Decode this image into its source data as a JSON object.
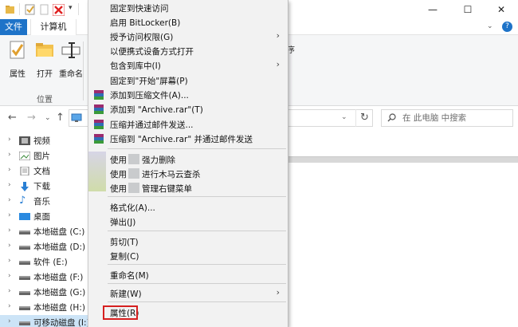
{
  "ribbon": {
    "tabs": [
      "文件",
      "计算机"
    ],
    "buttons": [
      "属性",
      "打开",
      "重命名"
    ],
    "group_label": "位置",
    "partial_label": "序"
  },
  "address": {
    "search_placeholder": "在 此电脑 中搜索"
  },
  "nav_pane": {
    "items": [
      {
        "label": "视频",
        "icon": "video-icon"
      },
      {
        "label": "图片",
        "icon": "pictures-icon"
      },
      {
        "label": "文档",
        "icon": "documents-icon"
      },
      {
        "label": "下载",
        "icon": "download-icon"
      },
      {
        "label": "音乐",
        "icon": "music-icon"
      },
      {
        "label": "桌面",
        "icon": "desktop-icon"
      },
      {
        "label": "本地磁盘 (C:)",
        "icon": "drive-icon"
      },
      {
        "label": "本地磁盘 (D:)",
        "icon": "drive-icon"
      },
      {
        "label": "软件 (E:)",
        "icon": "drive-icon"
      },
      {
        "label": "本地磁盘 (F:)",
        "icon": "drive-icon"
      },
      {
        "label": "本地磁盘 (G:)",
        "icon": "drive-icon"
      },
      {
        "label": "本地磁盘 (H:)",
        "icon": "drive-icon"
      },
      {
        "label": "可移动磁盘 (I:)",
        "icon": "usb-drive-icon"
      }
    ]
  },
  "context_menu": {
    "items": [
      {
        "label": "固定到快速访问",
        "has_submenu": false
      },
      {
        "label": "启用 BitLocker(B)",
        "has_submenu": false
      },
      {
        "label": "授予访问权限(G)",
        "has_submenu": true
      },
      {
        "label": "以便携式设备方式打开",
        "has_submenu": false
      },
      {
        "label": "包含到库中(I)",
        "has_submenu": true
      },
      {
        "label": "固定到\"开始\"屏幕(P)",
        "has_submenu": false
      },
      {
        "label": "添加到压缩文件(A)...",
        "has_submenu": false,
        "icon": "winrar-icon"
      },
      {
        "label": "添加到 \"Archive.rar\"(T)",
        "has_submenu": false,
        "icon": "winrar-icon"
      },
      {
        "label": "压缩并通过邮件发送...",
        "has_submenu": false,
        "icon": "winrar-icon"
      },
      {
        "label": "压缩到 \"Archive.rar\" 并通过邮件发送",
        "has_submenu": false,
        "icon": "winrar-icon"
      },
      {
        "label": "使用",
        "suffix": "强力删除",
        "has_submenu": false
      },
      {
        "label": "使用",
        "suffix": "进行木马云查杀",
        "has_submenu": false
      },
      {
        "label": "使用",
        "suffix": "管理右键菜单",
        "has_submenu": false
      },
      {
        "label": "格式化(A)...",
        "has_submenu": false
      },
      {
        "label": "弹出(J)",
        "has_submenu": false
      },
      {
        "label": "剪切(T)",
        "has_submenu": false
      },
      {
        "label": "复制(C)",
        "has_submenu": false
      },
      {
        "label": "重命名(M)",
        "has_submenu": false
      },
      {
        "label": "新建(W)",
        "has_submenu": true
      },
      {
        "label": "属性(R)",
        "has_submenu": false,
        "highlighted": true
      }
    ]
  },
  "colors": {
    "file_tab": "#1e73c8",
    "highlight_box": "#d62020",
    "menu_bg": "#f2f2f2"
  }
}
